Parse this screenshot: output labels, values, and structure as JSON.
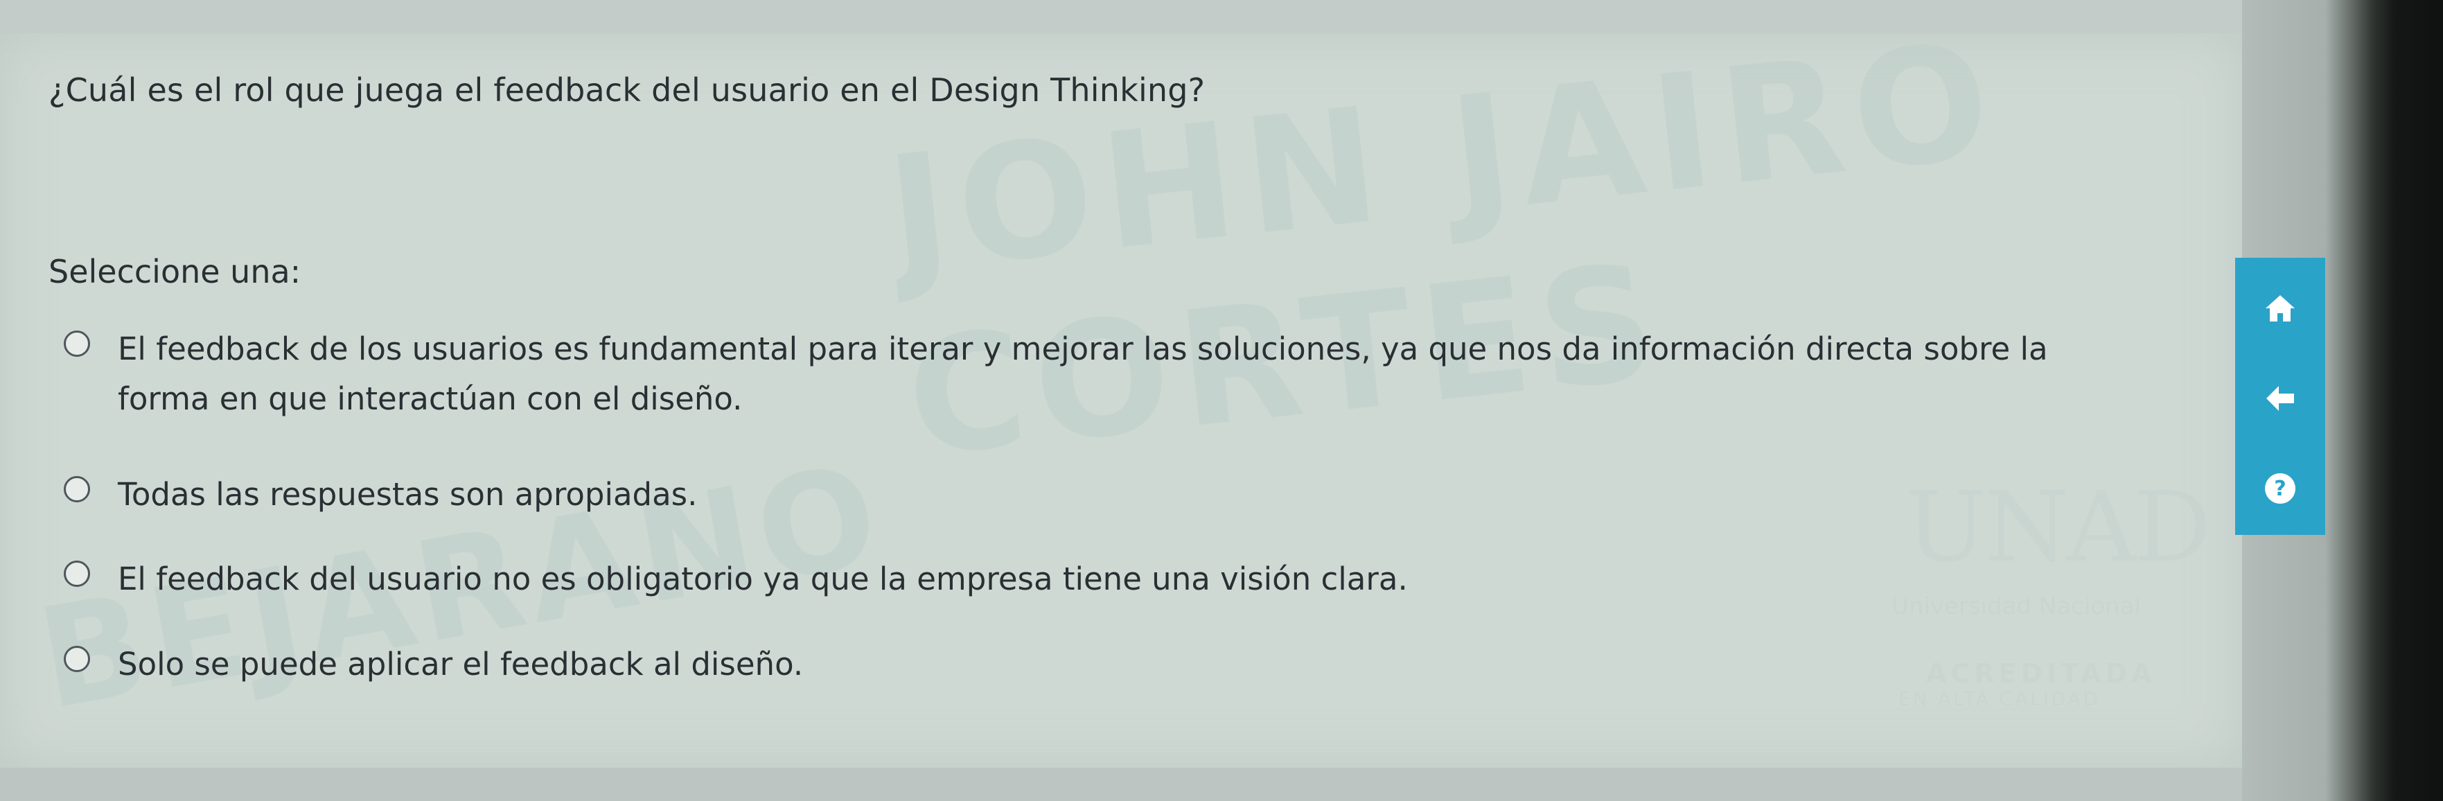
{
  "question": {
    "text": "¿Cuál es el rol que juega el feedback del usuario en el Design Thinking?",
    "prompt": "Seleccione una:"
  },
  "options": [
    {
      "label": "El feedback de los usuarios es fundamental para iterar y mejorar las soluciones, ya que nos da información directa sobre la forma en que interactúan con el diseño.",
      "selected": false
    },
    {
      "label": "Todas las respuestas son apropiadas.",
      "selected": false
    },
    {
      "label": "El feedback del usuario no es obligatorio ya que la empresa tiene una visión clara.",
      "selected": false
    },
    {
      "label": "Solo se puede aplicar el feedback al diseño.",
      "selected": false
    }
  ],
  "watermark": {
    "line1": "JOHN JAIRO CORTES",
    "line2": "BEJARANO"
  },
  "logo": {
    "name": "UNAD",
    "subtitle": "Universidad Nacional",
    "badge1": "ACREDITADA",
    "badge2": "EN ALTA CALIDAD"
  },
  "side_nav": {
    "icons": [
      "home-icon",
      "back-arrow-icon",
      "help-icon"
    ],
    "color": "#2aa3c8"
  }
}
